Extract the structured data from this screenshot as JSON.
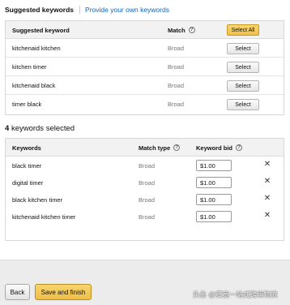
{
  "tabs": {
    "active": "Suggested keywords",
    "link": "Provide your own keywords"
  },
  "suggested": {
    "headers": {
      "keyword": "Suggested keyword",
      "match": "Match",
      "select_all": "Select All"
    },
    "rows": [
      {
        "keyword": "kitchenaid kitchen",
        "match": "Broad",
        "action": "Select"
      },
      {
        "keyword": "kitchen timer",
        "match": "Broad",
        "action": "Select"
      },
      {
        "keyword": "kitchenaid black",
        "match": "Broad",
        "action": "Select"
      },
      {
        "keyword": "timer black",
        "match": "Broad",
        "action": "Select"
      }
    ]
  },
  "selected": {
    "count": "4",
    "heading_suffix": "keywords selected",
    "headers": {
      "keywords": "Keywords",
      "match_type": "Match type",
      "keyword_bid": "Keyword bid"
    },
    "rows": [
      {
        "keyword": "black timer",
        "match": "Broad",
        "bid": "$1.00"
      },
      {
        "keyword": "digital timer",
        "match": "Broad",
        "bid": "$1.00"
      },
      {
        "keyword": "black kitchen timer",
        "match": "Broad",
        "bid": "$1.00"
      },
      {
        "keyword": "kitchenaid kitchen timer",
        "match": "Broad",
        "bid": "$1.00"
      }
    ]
  },
  "footer": {
    "back": "Back",
    "save": "Save and finish"
  },
  "watermark": "头条 @贤宽一站式跨境物流",
  "icons": {
    "help": "help-circle-icon",
    "remove": "close-x-icon"
  },
  "colors": {
    "link": "#0a66c2",
    "primary_button": "#f0c14b",
    "header_bg": "#f2f2f2",
    "footer_bg": "#ececec"
  }
}
